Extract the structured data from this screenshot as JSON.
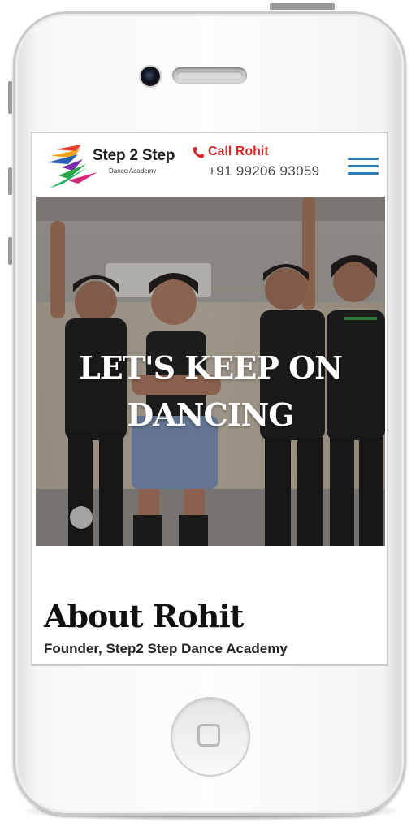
{
  "device": {
    "model": "phone-mockup"
  },
  "header": {
    "logo_name": "Step 2 Step",
    "logo_tagline": "Dance Academy",
    "call_label": "Call Rohit",
    "call_number": "+91 99206 93059",
    "phone_icon": "phone-icon",
    "menu_icon": "hamburger-menu-icon",
    "accent_color": "#d62a2a",
    "menu_color": "#2a7bbd"
  },
  "hero": {
    "title": "LET'S KEEP ON DANCING",
    "image": "children-dancing-photo"
  },
  "about": {
    "title": "About Rohit",
    "subtitle": "Founder, Step2 Step Dance Academy"
  }
}
